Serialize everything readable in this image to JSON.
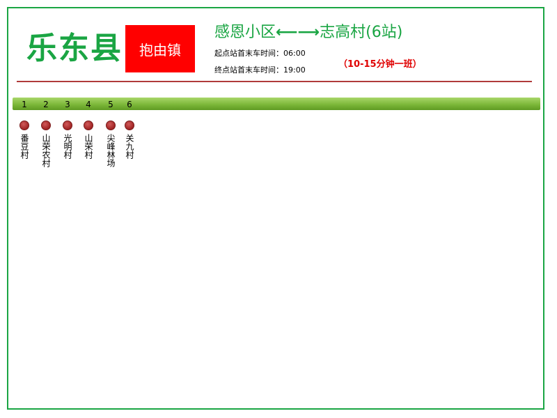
{
  "county": "乐东县",
  "town": "抱由镇",
  "route": {
    "from": "感恩小区",
    "arrow": "⟵⟶",
    "to": "志高村",
    "count": "(6站)"
  },
  "times": {
    "first_last_start": "起点站首末车时间：06:00",
    "first_last_end": "终点站首末车时间：19:00"
  },
  "frequency": "（10-15分钟一班）",
  "colors": {
    "accent_green": "#1aa543",
    "town_red": "#ff0000",
    "frequency_red": "#e00000",
    "stop_dot": "#a02424",
    "bar_green": "#7db83a"
  },
  "stops": [
    {
      "num": "1",
      "name": "番豆村"
    },
    {
      "num": "2",
      "name": "山荣农村"
    },
    {
      "num": "3",
      "name": "光明村"
    },
    {
      "num": "4",
      "name": "山荣村"
    },
    {
      "num": "5",
      "name": "尖峰林场"
    },
    {
      "num": "6",
      "name": "关九村"
    }
  ]
}
